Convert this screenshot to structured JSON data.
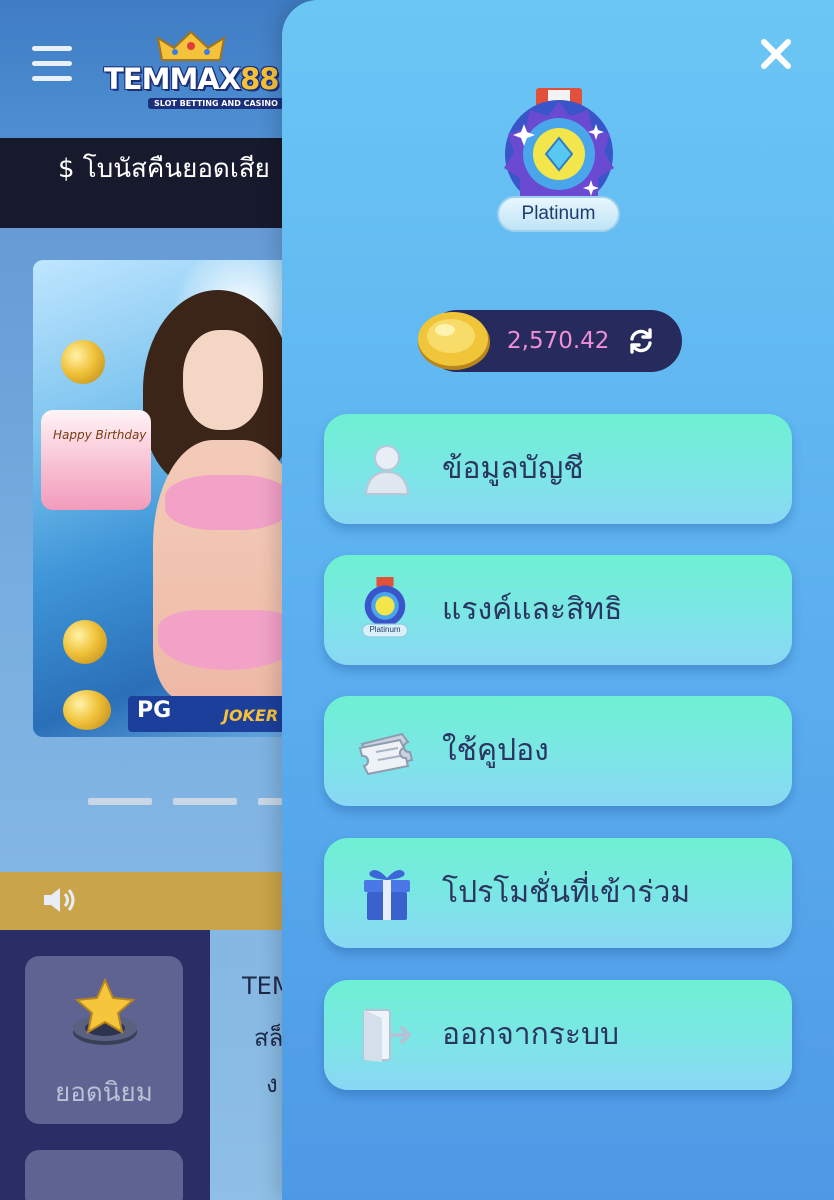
{
  "app": {
    "brand": {
      "name_text": "TEMMAX",
      "name_number": "88",
      "tagline": "SLOT BETTING AND CASINO"
    },
    "promo_text": "$ โบนัสคืนยอดเสีย",
    "banner": {
      "cake_text": "Happy Birthday",
      "provider_pg": "PG",
      "provider_joker": "JOKER"
    },
    "category_label": "ยอดนิยม",
    "intro_lines": [
      "TEM",
      "สล็",
      "ง"
    ]
  },
  "drawer": {
    "rank_badge_label": "Platinum",
    "rank_mini_label": "Platinum",
    "balance": "2,570.42",
    "menu": [
      {
        "label": "ข้อมูลบัญชี",
        "icon": "user-profile-icon"
      },
      {
        "label": "แรงค์และสิทธิ",
        "icon": "rank-medal-icon"
      },
      {
        "label": "ใช้คูปอง",
        "icon": "coupon-ticket-icon"
      },
      {
        "label": "โปรโมชั่นที่เข้าร่วม",
        "icon": "gift-box-icon"
      },
      {
        "label": "ออกจากระบบ",
        "icon": "logout-door-icon"
      }
    ]
  },
  "colors": {
    "drawer_top": "#6bc6f5",
    "drawer_bottom": "#4e99e6",
    "menu_button": "#7ce6e6",
    "balance_pill": "#262a5c",
    "balance_text": "#f08fd6",
    "promo_bar": "#161a2c",
    "ticker_bar": "#c9a44a"
  }
}
